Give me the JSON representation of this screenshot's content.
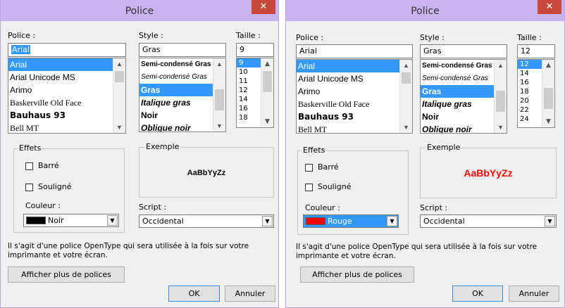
{
  "dialog_left": {
    "title": "Police",
    "close_glyph": "✕",
    "font_label": "Police :",
    "font_value": "Arial",
    "fonts": [
      "Arial",
      "Arial Unicode MS",
      "Arimo",
      "Baskerville Old Face",
      "Bauhaus 93",
      "Bell MT"
    ],
    "style_label": "Style :",
    "style_value": "Gras",
    "styles": [
      "Semi-condensé Gras",
      "Semi-condensé Gras",
      "Gras",
      "Italique gras",
      "Noir",
      "Oblique noir"
    ],
    "size_label": "Taille :",
    "size_value": "9",
    "sizes": [
      "9",
      "10",
      "11",
      "12",
      "14",
      "16",
      "18"
    ],
    "effects_label": "Effets",
    "strike_label": "Barré",
    "underline_label": "Souligné",
    "color_label": "Couleur :",
    "color_value": "Noir",
    "color_swatch": "#000000",
    "sample_label": "Exemple",
    "sample_text": "AaBbYyZz",
    "sample_color": "#000000",
    "script_label": "Script :",
    "script_value": "Occidental",
    "info_line1": "Il s'agit d'une police OpenType qui sera utilisée à la fois sur votre",
    "info_line2": "imprimante et votre écran.",
    "more_fonts_button": "Afficher plus de polices",
    "ok_button": "OK",
    "cancel_button": "Annuler"
  },
  "dialog_right": {
    "title": "Police",
    "close_glyph": "✕",
    "font_label": "Police :",
    "font_value": "Arial",
    "fonts": [
      "Arial",
      "Arial Unicode MS",
      "Arimo",
      "Baskerville Old Face",
      "Bauhaus 93",
      "Bell MT"
    ],
    "style_label": "Style :",
    "style_value": "Gras",
    "styles": [
      "Semi-condensé Gras",
      "Semi-condensé Gras",
      "Gras",
      "Italique gras",
      "Noir",
      "Oblique noir"
    ],
    "size_label": "Taille :",
    "size_value": "12",
    "sizes": [
      "12",
      "14",
      "16",
      "18",
      "20",
      "22",
      "24"
    ],
    "effects_label": "Effets",
    "strike_label": "Barré",
    "underline_label": "Souligné",
    "color_label": "Couleur :",
    "color_value": "Rouge",
    "color_swatch": "#ff0000",
    "sample_label": "Exemple",
    "sample_text": "AaBbYyZz",
    "sample_color": "#ff0000",
    "script_label": "Script :",
    "script_value": "Occidental",
    "info_line1": "Il s'agit d'une police OpenType qui sera utilisée à la fois sur votre",
    "info_line2": "imprimante et votre écran.",
    "more_fonts_button": "Afficher plus de polices",
    "ok_button": "OK",
    "cancel_button": "Annuler"
  }
}
